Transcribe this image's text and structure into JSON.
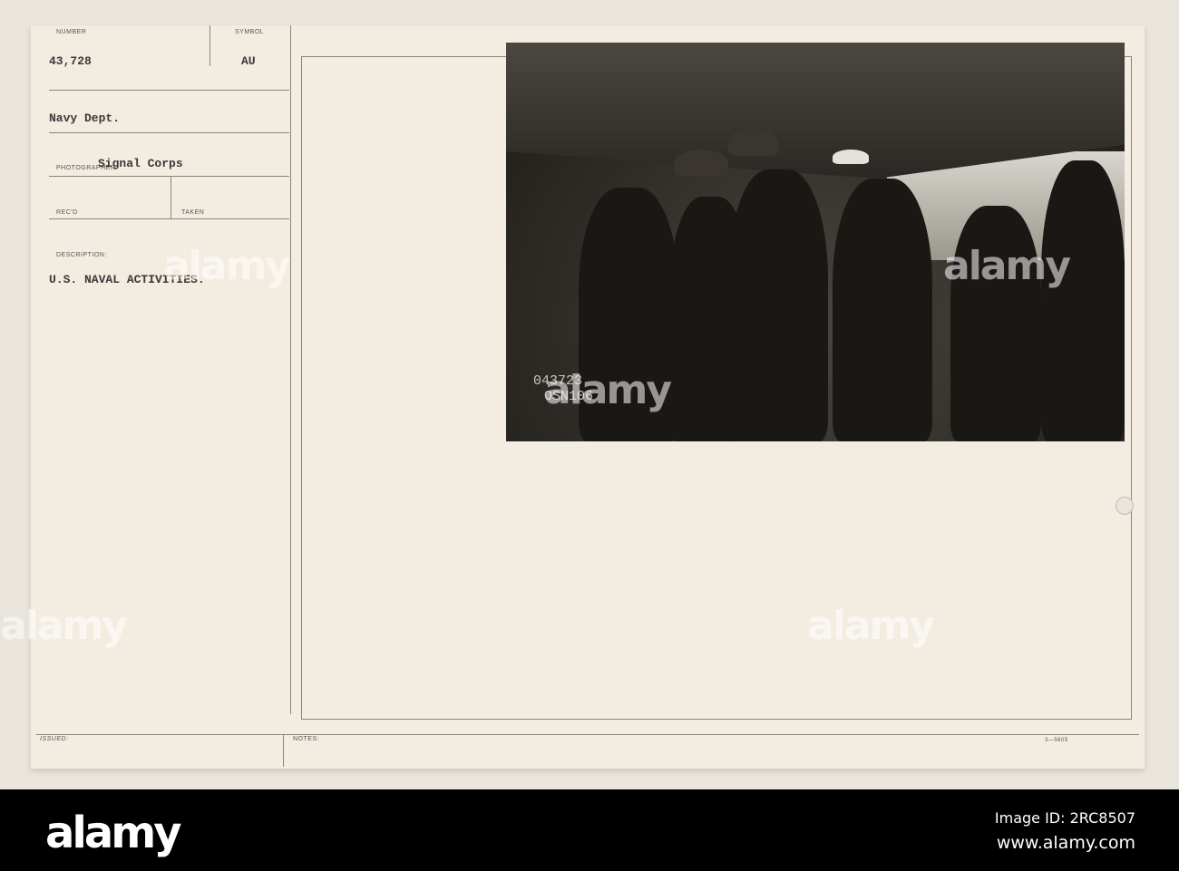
{
  "card": {
    "number_label": "NUMBER",
    "number_value": "43,728",
    "symbol_label": "SYMBOL",
    "symbol_value": "AU",
    "source": "Navy Dept.",
    "photographer_label": "PHOTOGRAPHER",
    "photographer_value": "Signal Corps",
    "recd_label": "REC'D",
    "taken_label": "TAKEN",
    "description_label": "DESCRIPTION:",
    "description_value": "U.S. NAVAL ACTIVITIES.",
    "issued_label": "ISSUED:",
    "notes_label": "NOTES:",
    "form_number": "3—5605"
  },
  "photo": {
    "stamp_line1": "043723",
    "stamp_line2": "OSN106"
  },
  "watermark": {
    "text": "alamy",
    "image_id": "Image ID: 2RC8507",
    "url": "www.alamy.com"
  }
}
